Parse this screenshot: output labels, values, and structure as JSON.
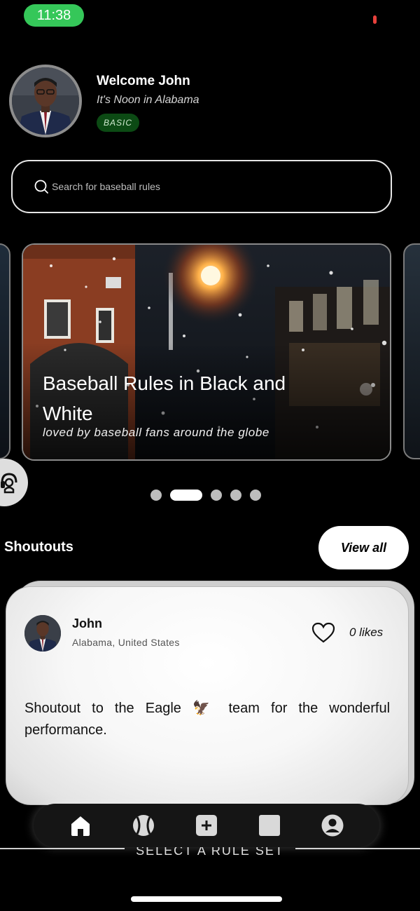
{
  "status_bar": {
    "time": "11:38"
  },
  "header": {
    "welcome": "Welcome John",
    "subtitle": "It's Noon in Alabama",
    "plan_badge": "BASIC"
  },
  "search": {
    "placeholder": "Search for baseball rules"
  },
  "carousel": {
    "active_index": 1,
    "slide_count": 5,
    "banner": {
      "title": "Baseball Rules in Black and White",
      "subtitle": "loved by baseball fans around the globe"
    }
  },
  "shoutouts": {
    "title": "Shoutouts",
    "view_all_label": "View all",
    "post": {
      "name": "John",
      "location": "Alabama, United States",
      "likes_label": "0 likes",
      "text_before": "Shoutout to the Eagle",
      "emoji": "🦅",
      "text_after": "team for the wonderful performance."
    }
  },
  "bottom": {
    "select_rule_set": "SELECT A RULE SET",
    "nav": [
      "home-icon",
      "baseball-icon",
      "add-icon",
      "square-icon",
      "profile-icon"
    ]
  },
  "colors": {
    "accent_green": "#35c759",
    "badge_green": "#0c4a14",
    "background": "#000000"
  }
}
